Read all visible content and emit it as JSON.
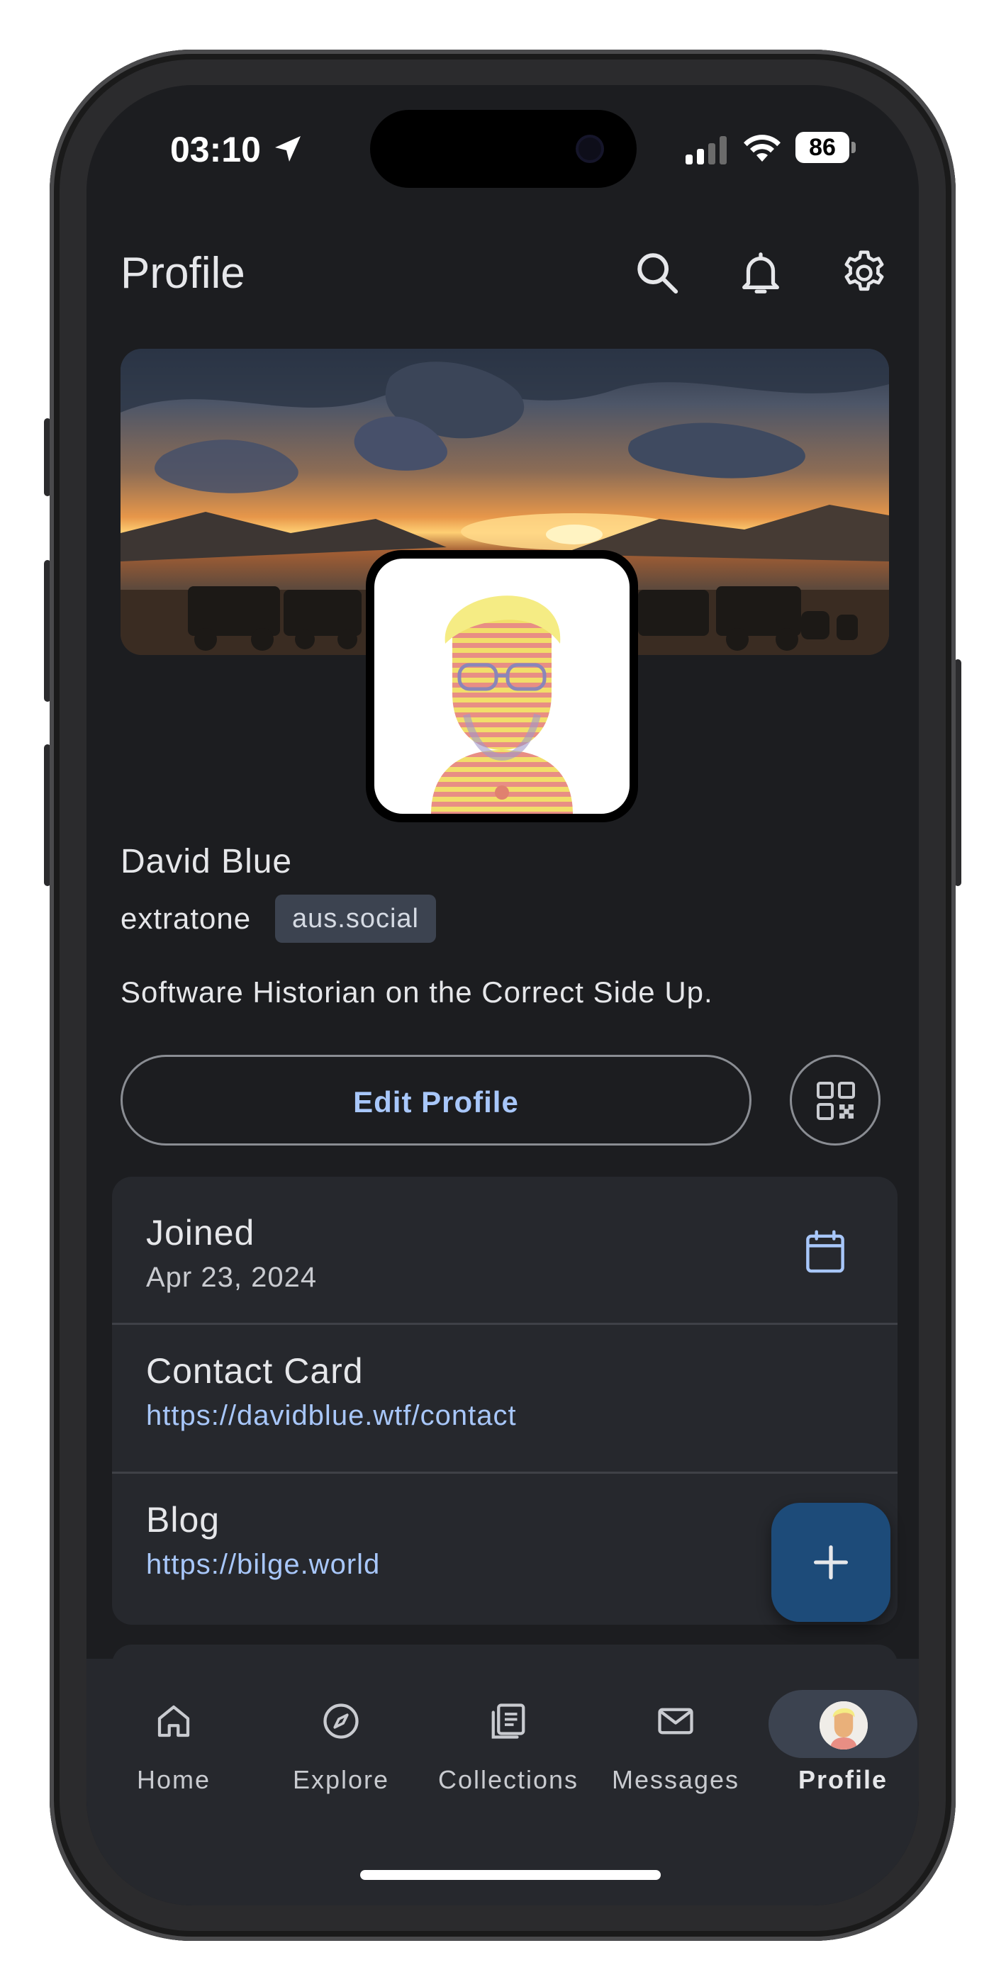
{
  "status_bar": {
    "time": "03:10",
    "battery": "86"
  },
  "header": {
    "title": "Profile"
  },
  "profile": {
    "display_name": "David Blue",
    "username": "extratone",
    "instance": "aus.social",
    "bio": "Software Historian on the Correct Side Up."
  },
  "actions": {
    "edit_profile_label": "Edit Profile"
  },
  "info": {
    "joined_label": "Joined",
    "joined_date": "Apr 23, 2024",
    "contact_label": "Contact Card",
    "contact_url": "https://davidblue.wtf/contact",
    "blog_label": "Blog",
    "blog_url": "https://bilge.world"
  },
  "nav": {
    "items": [
      {
        "label": "Home",
        "icon": "home-icon"
      },
      {
        "label": "Explore",
        "icon": "compass-icon"
      },
      {
        "label": "Collections",
        "icon": "collections-icon"
      },
      {
        "label": "Messages",
        "icon": "envelope-icon"
      },
      {
        "label": "Profile",
        "icon": "avatar"
      }
    ],
    "active": "Profile"
  },
  "colors": {
    "background": "#1c1d20",
    "card": "#26282d",
    "link": "#a8c7fa",
    "fab": "#1d4b79",
    "badge": "#3c4350"
  }
}
